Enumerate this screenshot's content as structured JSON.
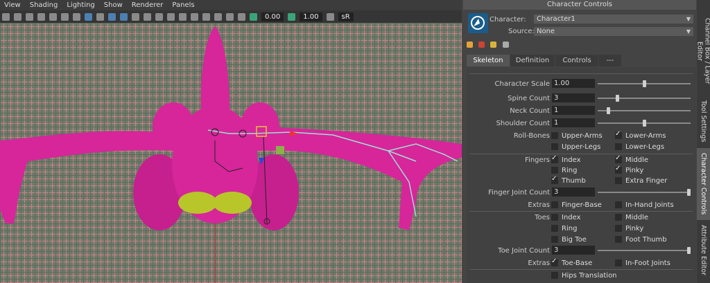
{
  "viewport": {
    "menu": [
      "View",
      "Shading",
      "Lighting",
      "Show",
      "Renderer",
      "Panels"
    ],
    "toolbar_values": {
      "field1": "0.00",
      "field2": "1.00",
      "label_sr": "sR"
    }
  },
  "panel": {
    "title": "Character Controls",
    "character_label": "Character:",
    "character_value": "Character1",
    "source_label": "Source:",
    "source_value": "None",
    "tabs": [
      "Skeleton",
      "Definition",
      "Controls",
      "---"
    ],
    "active_tab": "Skeleton",
    "skeleton": {
      "character_scale_label": "Character Scale",
      "character_scale": "1.00",
      "spine_count_label": "Spine Count",
      "spine_count": "3",
      "neck_count_label": "Neck Count",
      "neck_count": "1",
      "shoulder_count_label": "Shoulder Count",
      "shoulder_count": "1",
      "roll_bones_label": "Roll-Bones",
      "upper_arms": "Upper-Arms",
      "lower_arms": "Lower-Arms",
      "upper_legs": "Upper-Legs",
      "lower_legs": "Lower-Legs",
      "fingers_label": "Fingers",
      "index": "Index",
      "middle": "Middle",
      "ring": "Ring",
      "pinky": "Pinky",
      "thumb": "Thumb",
      "extra_finger": "Extra Finger",
      "finger_joint_count_label": "Finger Joint Count",
      "finger_joint_count": "3",
      "extras_label": "Extras",
      "finger_base": "Finger-Base",
      "in_hand_joints": "In-Hand Joints",
      "toes_label": "Toes",
      "toe_index": "Index",
      "toe_middle": "Middle",
      "toe_ring": "Ring",
      "toe_pinky": "Pinky",
      "big_toe": "Big Toe",
      "foot_thumb": "Foot Thumb",
      "toe_joint_count_label": "Toe Joint Count",
      "toe_joint_count": "3",
      "extras2_label": "Extras",
      "toe_base": "Toe-Base",
      "in_foot_joints": "In-Foot Joints",
      "hips_translation": "Hips Translation"
    },
    "checks": {
      "upper_arms": false,
      "lower_arms": true,
      "upper_legs": false,
      "lower_legs": false,
      "index": true,
      "middle": true,
      "ring": false,
      "pinky": true,
      "thumb": true,
      "extra_finger": false,
      "finger_base": false,
      "in_hand_joints": false,
      "toe_index": false,
      "toe_middle": false,
      "toe_ring": false,
      "toe_pinky": false,
      "big_toe": false,
      "foot_thumb": false,
      "toe_base": true,
      "in_foot_joints": false,
      "hips_translation": false
    },
    "sliders": {
      "character_scale": 0.5,
      "spine_count": 0.2,
      "neck_count": 0.1,
      "shoulder_count": 0.5,
      "finger_joint_count": 1.0,
      "toe_joint_count": 1.0
    }
  },
  "side_tabs": [
    "Channel Box / Layer Editor",
    "Tool Settings",
    "Character Controls",
    "Attribute Editor"
  ],
  "active_side_tab": "Character Controls",
  "colors": {
    "model": "#d6269a",
    "accent": "#4d7fb0",
    "grid": "#6d7b6a"
  }
}
